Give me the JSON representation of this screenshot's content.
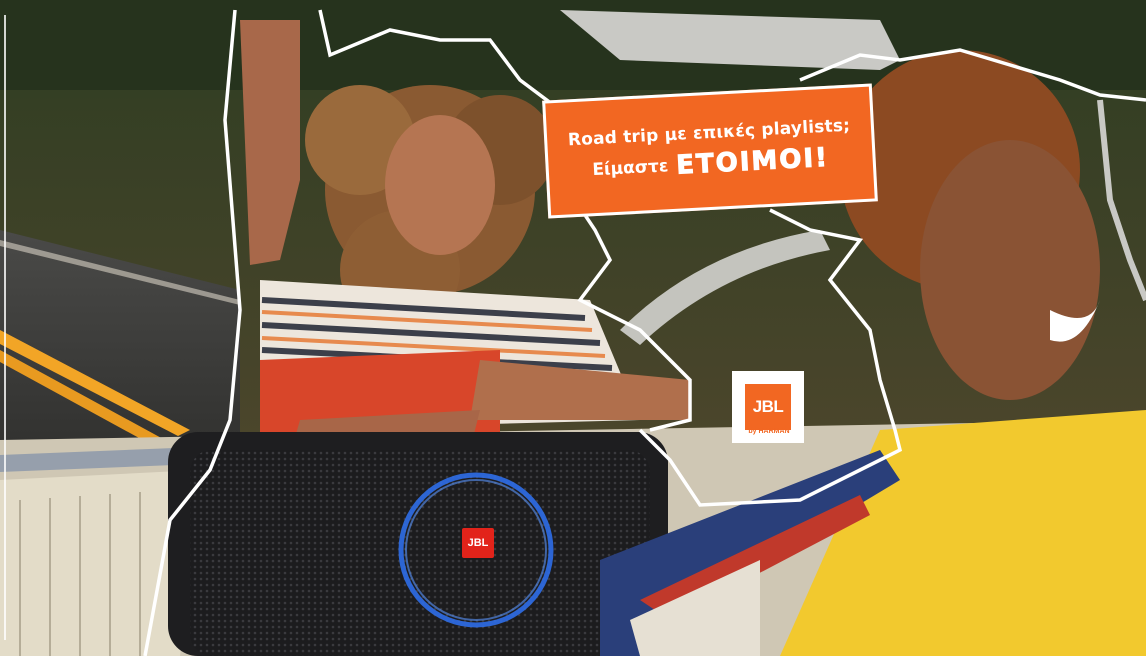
{
  "ad": {
    "banner_line1": "Road trip με επικές playlists;",
    "banner_line2_prefix": "Είμαστε",
    "banner_line2_word": "ΕΤΟΙΜΟΙ!"
  },
  "brand": {
    "logo_text": "JBL",
    "logo_subtext": "by HARMAN",
    "speaker_logo_text": "JBL",
    "accent_color": "#f26722"
  }
}
